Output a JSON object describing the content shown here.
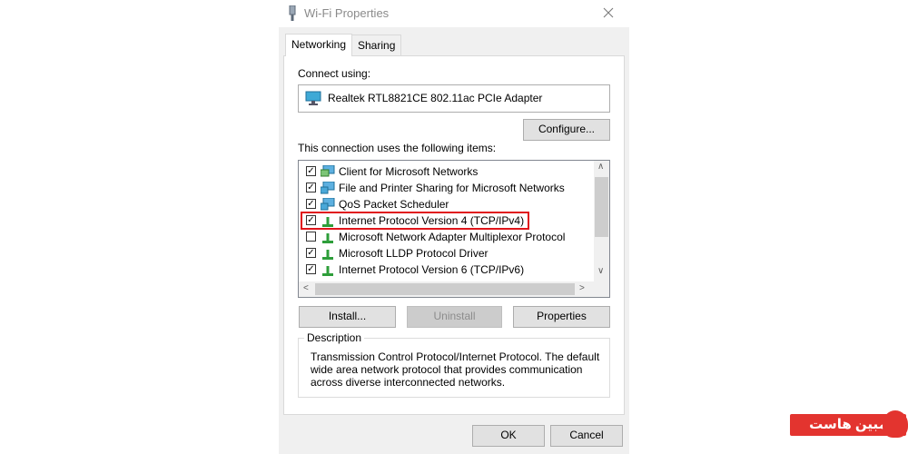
{
  "window": {
    "title": "Wi-Fi Properties",
    "icon": "network-adapter-icon",
    "close_icon": "close-icon"
  },
  "tabs": [
    {
      "label": "Networking",
      "active": true
    },
    {
      "label": "Sharing",
      "active": false
    }
  ],
  "connect_using": {
    "label": "Connect using:",
    "adapter": "Realtek RTL8821CE 802.11ac PCIe Adapter"
  },
  "buttons": {
    "configure": "Configure...",
    "install": "Install...",
    "uninstall": "Uninstall",
    "properties": "Properties",
    "ok": "OK",
    "cancel": "Cancel"
  },
  "items_label": "This connection uses the following items:",
  "items": [
    {
      "label": "Client for Microsoft Networks",
      "checked": true,
      "icon": "network-client-icon"
    },
    {
      "label": "File and Printer Sharing for Microsoft Networks",
      "checked": true,
      "icon": "network-service-icon"
    },
    {
      "label": "QoS Packet Scheduler",
      "checked": true,
      "icon": "network-service-icon"
    },
    {
      "label": "Internet Protocol Version 4 (TCP/IPv4)",
      "checked": true,
      "icon": "protocol-icon",
      "highlighted": true
    },
    {
      "label": "Microsoft Network Adapter Multiplexor Protocol",
      "checked": false,
      "icon": "protocol-icon"
    },
    {
      "label": "Microsoft LLDP Protocol Driver",
      "checked": true,
      "icon": "protocol-icon"
    },
    {
      "label": "Internet Protocol Version 6 (TCP/IPv6)",
      "checked": true,
      "icon": "protocol-icon"
    }
  ],
  "description": {
    "title": "Description",
    "text": "Transmission Control Protocol/Internet Protocol. The default wide area network protocol that provides communication across diverse interconnected networks."
  },
  "watermark": {
    "text": "مبین هاست"
  },
  "colors": {
    "highlight": "#e0151b",
    "dialog_bg": "#f0f0f0",
    "watermark": "#e3342f"
  }
}
